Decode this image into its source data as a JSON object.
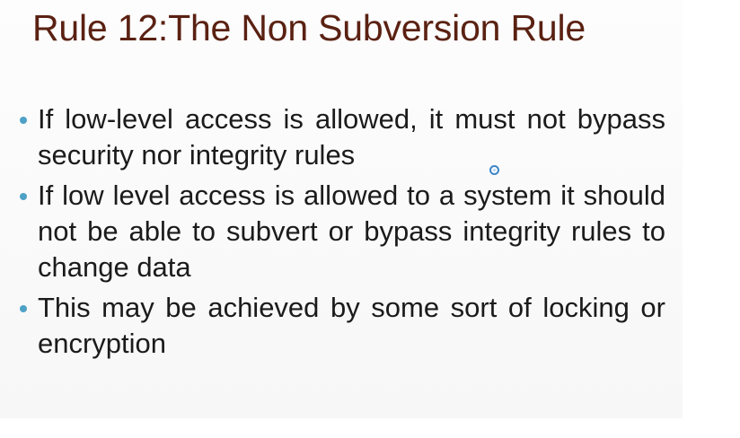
{
  "slide": {
    "title": "Rule 12:The Non Subversion Rule",
    "bullets": [
      {
        "text": "If low-level access is allowed, it must not bypass security nor integrity rules"
      },
      {
        "text": "If low level access is allowed to a system it should not be able to subvert or bypass integrity rules to change data"
      },
      {
        "text": "This may be achieved by some sort of locking or encryption"
      }
    ],
    "bullet_color": "#4ea1c6",
    "title_color": "#5a2112",
    "cursor_icon": "busy-cursor-icon"
  }
}
